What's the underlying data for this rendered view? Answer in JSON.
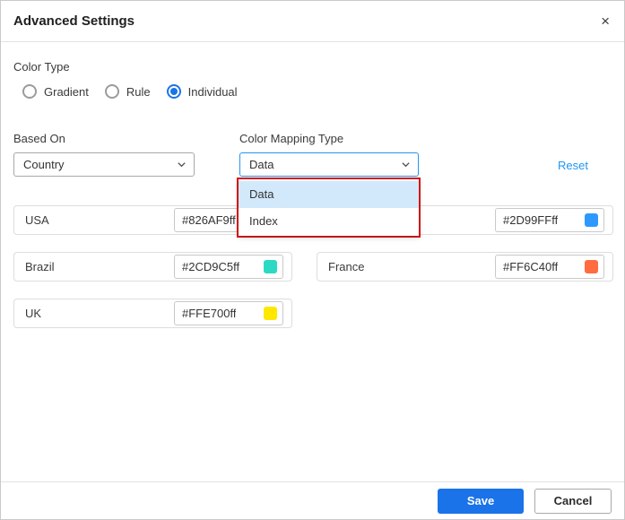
{
  "dialog": {
    "title": "Advanced Settings",
    "close_glyph": "×"
  },
  "color_type": {
    "label": "Color Type",
    "options": [
      {
        "label": "Gradient",
        "selected": false
      },
      {
        "label": "Rule",
        "selected": false
      },
      {
        "label": "Individual",
        "selected": true
      }
    ]
  },
  "based_on": {
    "label": "Based On",
    "value": "Country"
  },
  "color_mapping_type": {
    "label": "Color Mapping Type",
    "value": "Data"
  },
  "reset": {
    "label": "Reset"
  },
  "dropdown_list": {
    "options": [
      {
        "label": "Data",
        "selected": true
      },
      {
        "label": "Index",
        "selected": false
      }
    ]
  },
  "cards": [
    {
      "label": "USA",
      "value": "#826AF9ff",
      "swatch": "#826AF9"
    },
    {
      "label": "",
      "value": "#2D99FFff",
      "swatch": "#2D99FF"
    },
    {
      "label": "Brazil",
      "value": "#2CD9C5ff",
      "swatch": "#2CD9C5"
    },
    {
      "label": "France",
      "value": "#FF6C40ff",
      "swatch": "#FF6C40"
    },
    {
      "label": "UK",
      "value": "#FFE700ff",
      "swatch": "#FFE700"
    }
  ],
  "footer": {
    "save_label": "Save",
    "cancel_label": "Cancel"
  },
  "colors": {
    "accent_blue": "#1a73e8",
    "focus_border_blue": "#2196f3",
    "reset_link_blue": "#2196f3",
    "annotation_red": "#df1212",
    "selected_option_bg": "#d2e9fb"
  }
}
